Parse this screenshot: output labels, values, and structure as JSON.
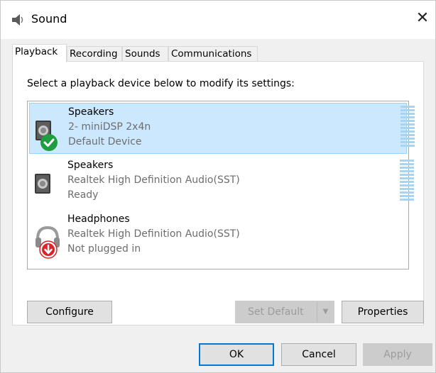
{
  "window": {
    "title": "Sound",
    "close_symbol": "✕"
  },
  "tabs": [
    {
      "label": "Playback",
      "active": true
    },
    {
      "label": "Recording",
      "active": false
    },
    {
      "label": "Sounds",
      "active": false
    },
    {
      "label": "Communications",
      "active": false
    }
  ],
  "panel": {
    "instruction": "Select a playback device below to modify its settings:",
    "devices": [
      {
        "name": "Speakers",
        "description": "2- miniDSP 2x4n",
        "status": "Default Device",
        "icon": "speaker-icon",
        "badge": "default-check-icon",
        "selected": true
      },
      {
        "name": "Speakers",
        "description": "Realtek High Definition Audio(SST)",
        "status": "Ready",
        "icon": "speaker-icon",
        "selected": false
      },
      {
        "name": "Headphones",
        "description": "Realtek High Definition Audio(SST)",
        "status": "Not plugged in",
        "icon": "headphones-icon",
        "badge": "unplugged-arrow-icon",
        "selected": false
      }
    ],
    "buttons": {
      "configure": "Configure",
      "set_default": "Set Default",
      "properties": "Properties"
    }
  },
  "footer": {
    "ok": "OK",
    "cancel": "Cancel",
    "apply": "Apply"
  },
  "colors": {
    "selection_bg": "#cce8ff",
    "selection_border": "#99d1ff",
    "accent": "#0078d7",
    "check_green": "#1e9e3e",
    "unplugged_red": "#d9252a"
  }
}
